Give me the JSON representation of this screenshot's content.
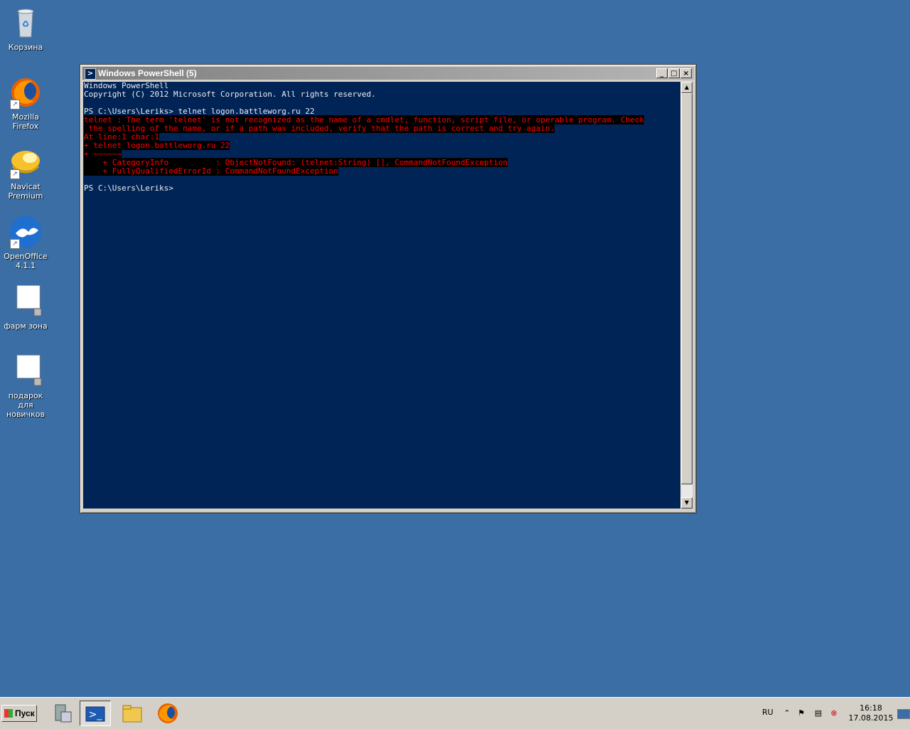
{
  "desktop": {
    "icons": [
      {
        "label": "Корзина"
      },
      {
        "label": "Mozilla Firefox"
      },
      {
        "label": "Navicat Premium"
      },
      {
        "label": "OpenOffice 4.1.1"
      },
      {
        "label": "фарм зона"
      },
      {
        "label": "подарок для новичков"
      }
    ]
  },
  "window": {
    "title": "Windows PowerShell (5)",
    "minimize": "_",
    "maximize": "□",
    "close": "×",
    "console_lines": [
      {
        "text": "Windows PowerShell",
        "type": "normal"
      },
      {
        "text": "Copyright (C) 2012 Microsoft Corporation. All rights reserved.",
        "type": "normal"
      },
      {
        "text": "",
        "type": "normal"
      },
      {
        "text": "PS C:\\Users\\Leriks> telnet logon.battleworg.ru 22",
        "type": "normal"
      },
      {
        "text": "telnet : The term 'telnet' is not recognized as the name of a cmdlet, function, script file, or operable program. Check",
        "type": "error"
      },
      {
        "text": " the spelling of the name, or if a path was included, verify that the path is correct and try again.",
        "type": "error"
      },
      {
        "text": "At line:1 char:1",
        "type": "error"
      },
      {
        "text": "+ telnet logon.battleworg.ru 22",
        "type": "error"
      },
      {
        "text": "+ ~~~~~~",
        "type": "error"
      },
      {
        "text": "    + CategoryInfo          : ObjectNotFound: (telnet:String) [], CommandNotFoundException",
        "type": "error"
      },
      {
        "text": "    + FullyQualifiedErrorId : CommandNotFoundException",
        "type": "error"
      },
      {
        "text": "",
        "type": "normal"
      },
      {
        "text": "PS C:\\Users\\Leriks>",
        "type": "normal"
      }
    ]
  },
  "taskbar": {
    "start_label": "Пуск",
    "language": "RU",
    "time": "16:18",
    "date": "17.08.2015"
  },
  "colors": {
    "desktop": "#3a6ea5",
    "console_bg": "#012456",
    "error_fg": "#ff0000"
  }
}
